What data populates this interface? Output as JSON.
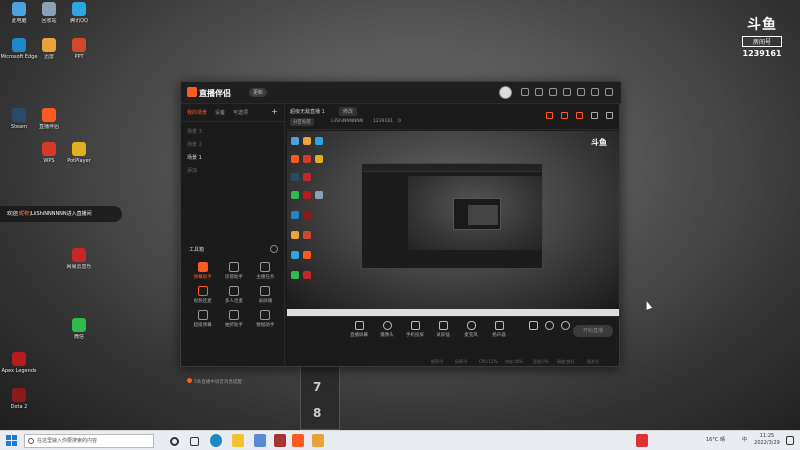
{
  "desktop_icons": [
    {
      "label": "此电脑",
      "color": "#4aa3df"
    },
    {
      "label": "回收站",
      "color": "#8aa0b5"
    },
    {
      "label": "腾讯QQ",
      "color": "#2ca5e0"
    },
    {
      "label": "Microsoft Edge",
      "color": "#1e88c6"
    },
    {
      "label": "迅雷",
      "color": "#e8a33a"
    },
    {
      "label": "PPT",
      "color": "#d04a2a"
    },
    {
      "label": "Steam",
      "color": "#2a4a6a"
    },
    {
      "label": "直播伴侣",
      "color": "#ff5a1f"
    },
    {
      "label": "WPS",
      "color": "#d23a2a"
    },
    {
      "label": "PotPlayer",
      "color": "#e0b020"
    },
    {
      "label": "网易云音乐",
      "color": "#c62828"
    },
    {
      "label": "Apex Legends",
      "color": "#b71c1c"
    },
    {
      "label": "Dota 2",
      "color": "#8b1a1a"
    },
    {
      "label": "微信",
      "color": "#2dbb4e"
    }
  ],
  "logo": {
    "mark": "斗鱼",
    "room_label": "房间号",
    "room_id": "1239161"
  },
  "toast": {
    "prefix": "欢迎",
    "name": "[昵称]",
    "text": "LiiShiNNNNNN进入直播间"
  },
  "window": {
    "brand": "直播伴侣",
    "version_badge": "更新",
    "tabs": [
      "我的场景",
      "设备",
      "可选项"
    ],
    "scenes": [
      "场景 3",
      "场景 2",
      "场景 1",
      "添加"
    ],
    "room_title": "超级无敌直播 1",
    "edit_label": "修改",
    "modify_label": "分区标签",
    "user": "LiiShiNNNNNN",
    "room_id": "1239161",
    "hot_count": "0",
    "tools_header": "工具箱",
    "tools": [
      "弹幕助手",
      "房管助手",
      "主播任务",
      "视频连麦",
      "多人连麦",
      "录屏播",
      "超级弹幕",
      "抽奖助手",
      "数据助手"
    ],
    "alert": "5条直播中语音消息提醒",
    "controls": [
      "直播屏幕",
      "摄像头",
      "手机投屏",
      "录屏插",
      "麦克风",
      "扬声器"
    ],
    "start_button": "开始直播",
    "status_items": [
      "帧率:0",
      "码率:0",
      "CPU:12%",
      "内存:40%",
      "丢帧:0%",
      "网络:良好",
      "版本号"
    ]
  },
  "taskbar": {
    "search_placeholder": "在这里输入你要搜索的内容",
    "tray_temp": "16°C 晴",
    "tray_lang": "中",
    "time": "11:25",
    "date": "2022/3/29"
  },
  "monitor_numbers": [
    "7",
    "8"
  ]
}
